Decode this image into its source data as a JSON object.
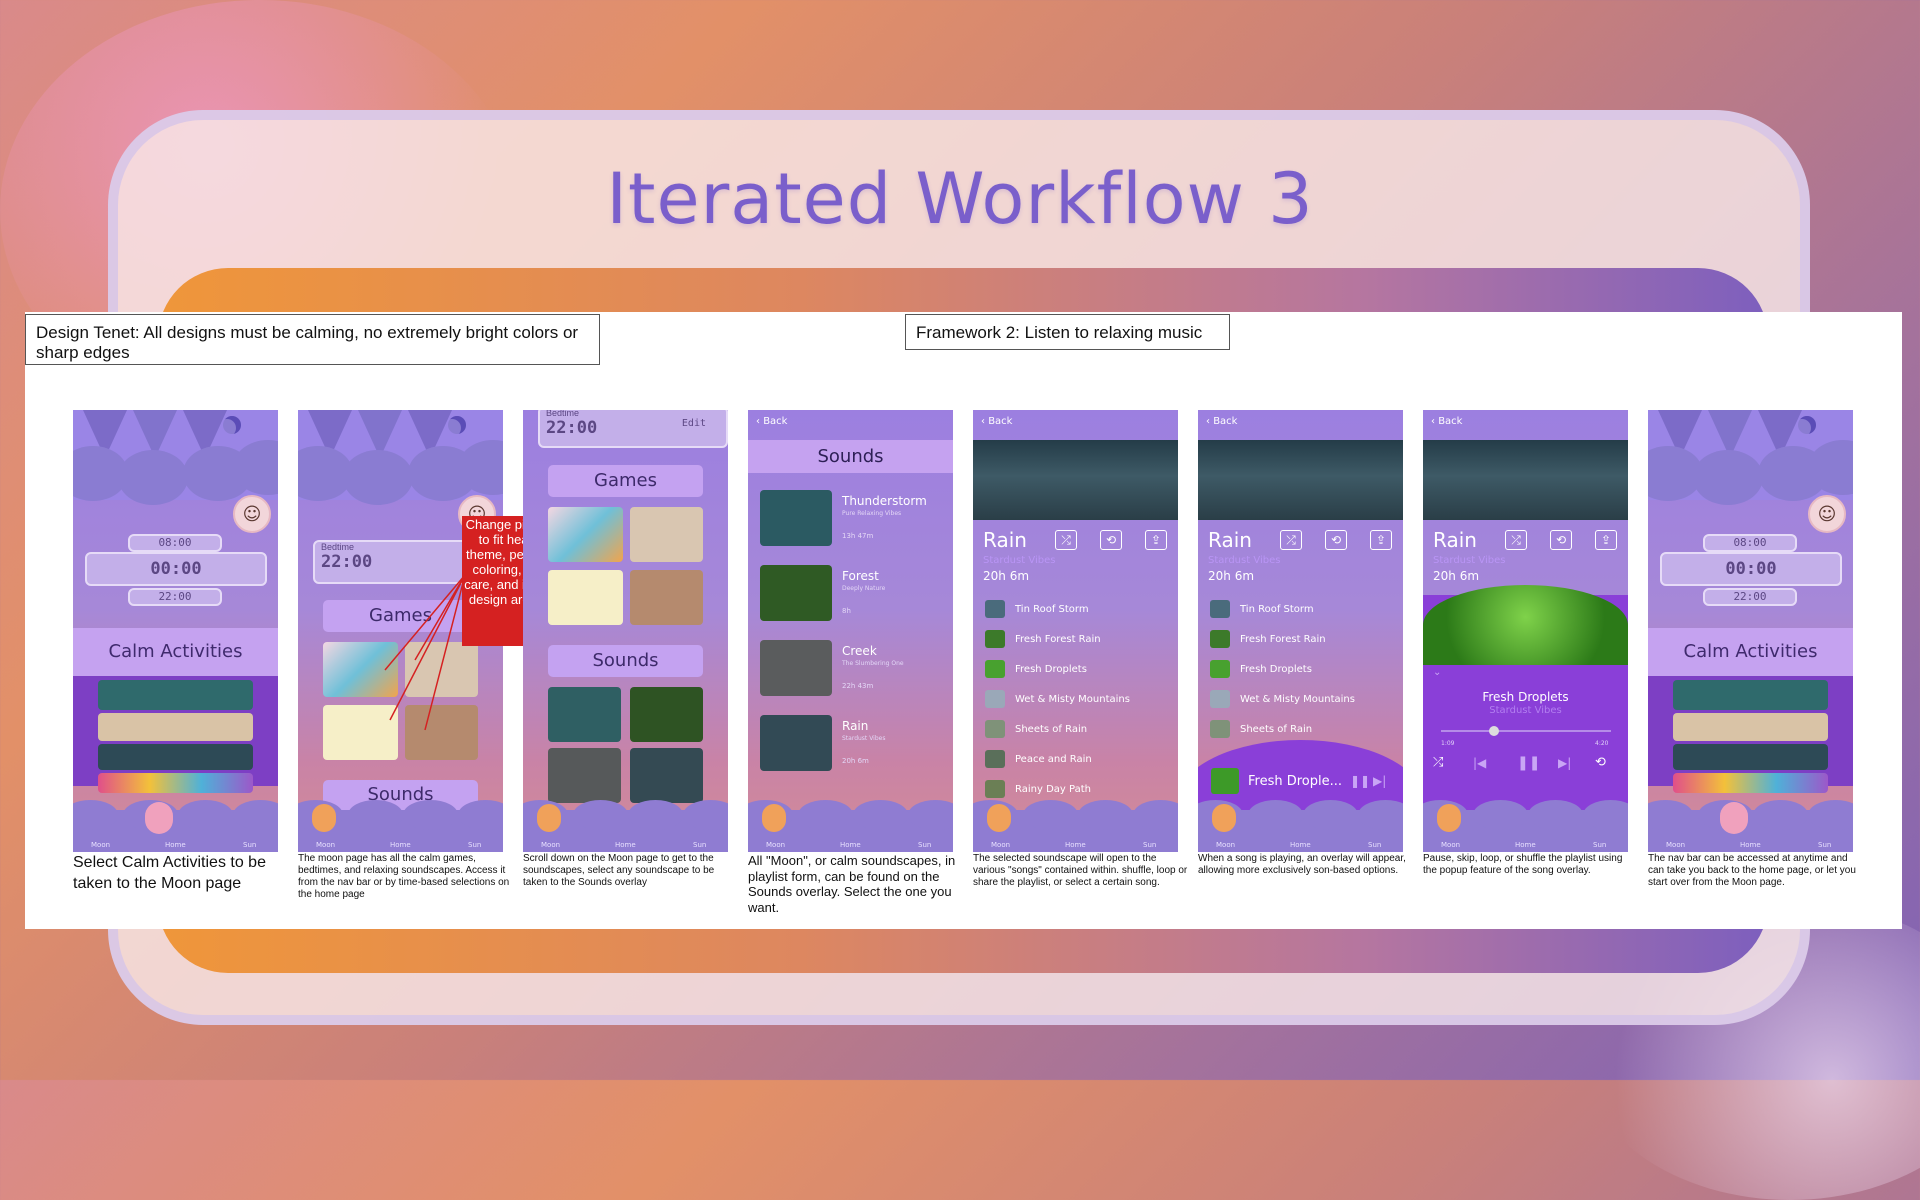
{
  "title": "Iterated Workflow 3",
  "notes": {
    "design_tenet": "Design Tenet: All designs must be calming, no extremely bright colors or sharp edges",
    "framework": "Framework 2: Listen to relaxing music",
    "red_note": "Change pictures to fit header theme, pet care, coloring, plant care, and interior design are ugly"
  },
  "nav": {
    "moon": "Moon",
    "home": "Home",
    "sun": "Sun"
  },
  "home_screen": {
    "alarm_time": "08:00",
    "clock": "00:00",
    "bed_time": "22:00",
    "calm_activities": "Calm Activities"
  },
  "moon_screen": {
    "bedtime_label": "Bedtime",
    "bedtime_value": "22:00",
    "edit": "Edit",
    "games": "Games",
    "sounds": "Sounds"
  },
  "sounds_screen": {
    "back": "Back",
    "header": "Sounds",
    "items": [
      {
        "title": "Thunderstorm",
        "artist": "Pure Relaxing Vibes",
        "duration": "13h 47m",
        "color": "#2b5a62"
      },
      {
        "title": "Forest",
        "artist": "Deeply Nature",
        "duration": "8h",
        "color": "#2f5a24"
      },
      {
        "title": "Creek",
        "artist": "The Slumbering One",
        "duration": "22h 43m",
        "color": "#5a5c5d"
      },
      {
        "title": "Rain",
        "artist": "Stardust Vibes",
        "duration": "20h 6m",
        "color": "#324a55"
      }
    ]
  },
  "playlist": {
    "back": "Back",
    "title": "Rain",
    "artist": "Stardust Vibes",
    "duration": "20h 6m",
    "songs": [
      {
        "name": "Tin Roof Storm",
        "color": "#4a6b7c"
      },
      {
        "name": "Fresh Forest Rain",
        "color": "#3c7a2a"
      },
      {
        "name": "Fresh Droplets",
        "color": "#48a12f"
      },
      {
        "name": "Wet & Misty Mountains",
        "color": "#9aa8b8"
      },
      {
        "name": "Sheets of Rain",
        "color": "#7f9279"
      },
      {
        "name": "Peace and Rain",
        "color": "#5a6f5a"
      },
      {
        "name": "Rainy Day Path",
        "color": "#6b7f55"
      }
    ]
  },
  "mini_player": {
    "song": "Fresh Drople..."
  },
  "now_playing": {
    "song": "Fresh Droplets",
    "artist": "Stardust Vibes",
    "elapsed": "1:09",
    "remaining": "4:20"
  },
  "captions": [
    "Select Calm Activities to be taken to the Moon page",
    "The moon page has all the calm games, bedtimes, and relaxing soundscapes. Access it from the nav bar or by time-based selections on the home page",
    "Scroll down on the Moon page to get to the soundscapes, select any soundscape to be taken to the Sounds overlay",
    "All \"Moon\", or calm soundscapes, in playlist form, can be found on the Sounds overlay. Select the one you want.",
    "The selected soundscape will open to the various \"songs\" contained within. shuffle, loop or share the playlist, or select a certain song.",
    "When a song is playing, an overlay will appear, allowing more exclusively son-based options.",
    "Pause, skip, loop, or shuffle the playlist using the popup feature of the song overlay.",
    "The nav bar can be accessed at anytime and can take you back to the home page, or let you start over from the Moon page."
  ]
}
